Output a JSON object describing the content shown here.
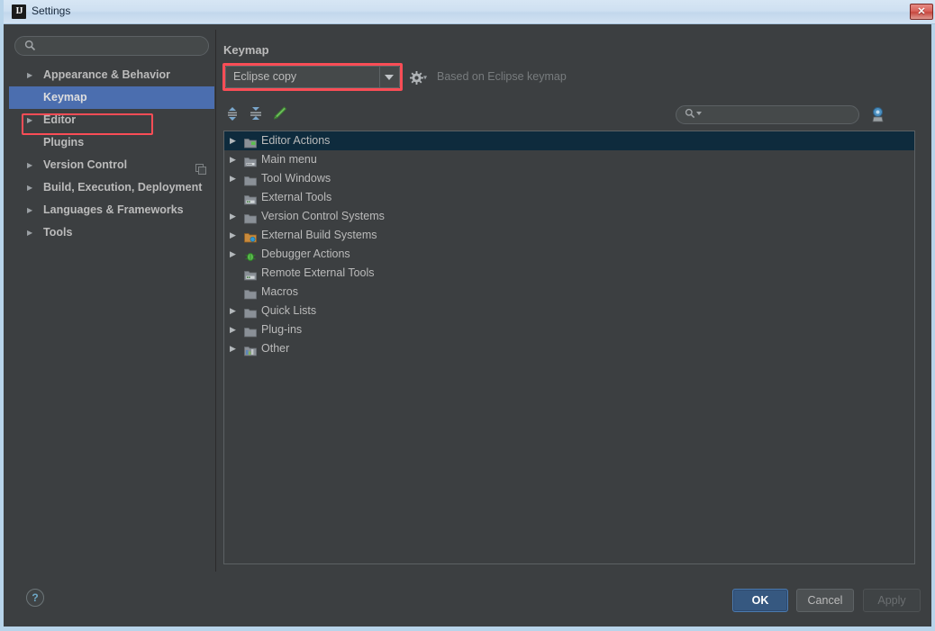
{
  "window": {
    "title": "Settings",
    "icon": "intellij-idea-icon",
    "close_label": "✕"
  },
  "sidebar": {
    "search": {
      "value": "",
      "placeholder": "",
      "icon": "search-icon"
    },
    "items": [
      {
        "label": "Appearance & Behavior",
        "arrow": "▶",
        "bold": true,
        "selected": false,
        "expandable": true,
        "right_icon": ""
      },
      {
        "label": "Keymap",
        "arrow": "",
        "bold": true,
        "selected": true,
        "expandable": false,
        "right_icon": ""
      },
      {
        "label": "Editor",
        "arrow": "▶",
        "bold": true,
        "selected": false,
        "expandable": true,
        "right_icon": ""
      },
      {
        "label": "Plugins",
        "arrow": "",
        "bold": true,
        "selected": false,
        "expandable": false,
        "right_icon": ""
      },
      {
        "label": "Version Control",
        "arrow": "▶",
        "bold": true,
        "selected": false,
        "expandable": true,
        "right_icon": "copy-stack-icon"
      },
      {
        "label": "Build, Execution, Deployment",
        "arrow": "▶",
        "bold": true,
        "selected": false,
        "expandable": true,
        "right_icon": ""
      },
      {
        "label": "Languages & Frameworks",
        "arrow": "▶",
        "bold": true,
        "selected": false,
        "expandable": true,
        "right_icon": ""
      },
      {
        "label": "Tools",
        "arrow": "▶",
        "bold": true,
        "selected": false,
        "expandable": true,
        "right_icon": ""
      }
    ]
  },
  "keymap": {
    "heading": "Keymap",
    "selected_keymap": "Eclipse copy",
    "keymap_options": [
      "Eclipse copy"
    ],
    "gear_icon": "gear-icon",
    "based_on": "Based on Eclipse keymap",
    "toolbar": {
      "expand_all": "expand-all-icon",
      "collapse_all": "collapse-all-icon",
      "edit_shortcut": "edit-pencil-icon"
    },
    "search": {
      "value": "",
      "placeholder": "",
      "icon": "search-icon"
    },
    "find_by_shortcut": "find-by-shortcut-icon",
    "tree": [
      {
        "label": "Editor Actions",
        "icon": "editor-actions-icon",
        "expandable": true,
        "selected": true
      },
      {
        "label": "Main menu",
        "icon": "main-menu-icon",
        "expandable": true,
        "selected": false
      },
      {
        "label": "Tool Windows",
        "icon": "folder-icon",
        "expandable": true,
        "selected": false
      },
      {
        "label": "External Tools",
        "icon": "external-tools-icon",
        "expandable": false,
        "selected": false
      },
      {
        "label": "Version Control Systems",
        "icon": "folder-icon",
        "expandable": true,
        "selected": false
      },
      {
        "label": "External Build Systems",
        "icon": "build-systems-icon",
        "expandable": true,
        "selected": false
      },
      {
        "label": "Debugger Actions",
        "icon": "debugger-bug-icon",
        "expandable": true,
        "selected": false
      },
      {
        "label": "Remote External Tools",
        "icon": "external-tools-icon",
        "expandable": false,
        "selected": false
      },
      {
        "label": "Macros",
        "icon": "folder-icon",
        "expandable": false,
        "selected": false
      },
      {
        "label": "Quick Lists",
        "icon": "folder-icon",
        "expandable": true,
        "selected": false
      },
      {
        "label": "Plug-ins",
        "icon": "folder-icon",
        "expandable": true,
        "selected": false
      },
      {
        "label": "Other",
        "icon": "other-icon",
        "expandable": true,
        "selected": false
      }
    ]
  },
  "footer": {
    "help_label": "?",
    "ok_label": "OK",
    "cancel_label": "Cancel",
    "apply_label": "Apply"
  },
  "colors": {
    "window_border": "#b8d4ea",
    "panel_bg": "#3c3f41",
    "text": "#bbbbbb",
    "sidebar_selection": "#4b6eaf",
    "tree_selection": "#0e2b3d",
    "highlight_box": "#fa4d56",
    "ok_button": "#365880",
    "close_button": "#d9635c"
  }
}
